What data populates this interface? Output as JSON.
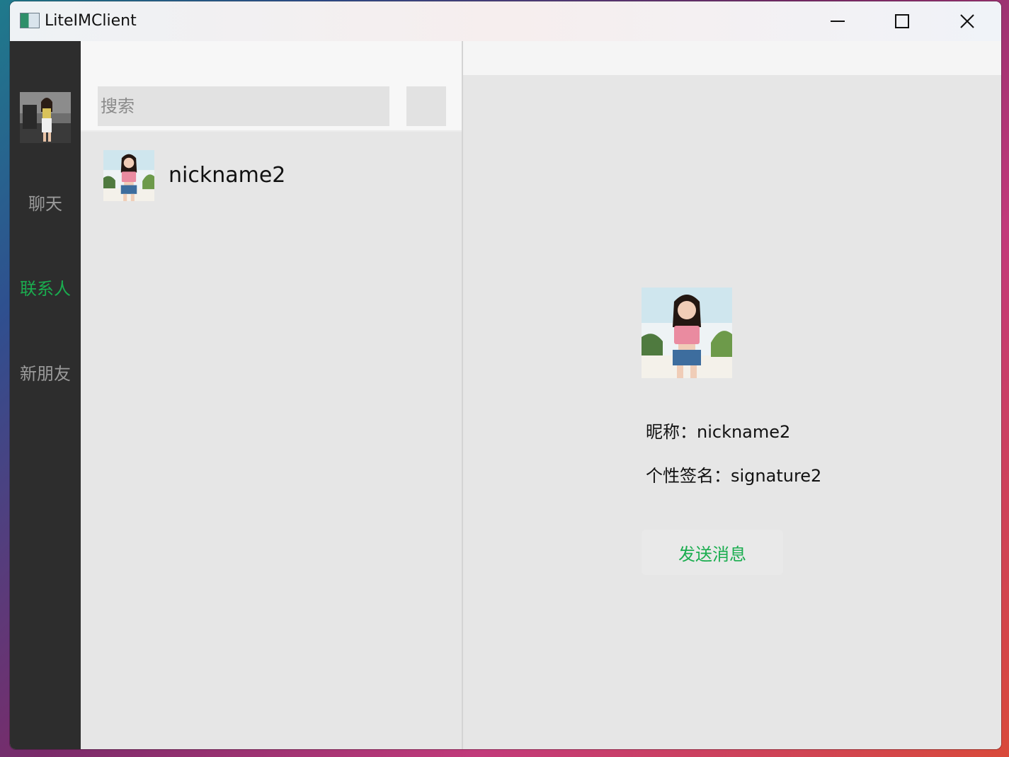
{
  "window": {
    "title": "LiteIMClient",
    "icon": "app-icon"
  },
  "titlebar_buttons": {
    "minimize_icon": "minimize-icon",
    "maximize_icon": "maximize-icon",
    "close_icon": "close-icon"
  },
  "sidebar": {
    "avatar": "user-avatar-photo",
    "items": [
      {
        "label": "聊天",
        "active": false
      },
      {
        "label": "联系人",
        "active": true
      },
      {
        "label": "新朋友",
        "active": false
      }
    ]
  },
  "contacts_panel": {
    "search": {
      "placeholder": "搜索",
      "value": ""
    },
    "add_button_icon": "add-contact-button",
    "contacts": [
      {
        "nickname": "nickname2",
        "avatar": "contact-avatar-photo"
      }
    ]
  },
  "detail": {
    "avatar": "contact-avatar-photo",
    "nickname_line": "昵称：nickname2",
    "signature_line": "个性签名：signature2",
    "send_button_label": "发送消息"
  },
  "colors": {
    "accent_green": "#1aad4f",
    "sidebar_bg": "#2d2d2d",
    "panel_bg": "#e6e6e6",
    "inactive_nav_text": "#9a9a9a"
  }
}
